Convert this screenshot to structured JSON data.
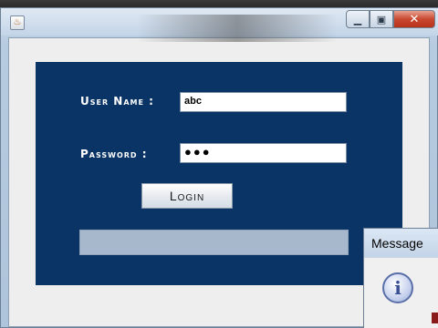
{
  "window": {
    "app_icon_glyph": "♨",
    "controls": {
      "minimize_glyph": "▁",
      "maximize_glyph": "▣",
      "close_glyph": "✕"
    }
  },
  "login_form": {
    "username_label": "User Name :",
    "username_value": "abc",
    "password_label": "Password :",
    "password_value": "●●●",
    "login_button_label": "Login"
  },
  "message_dialog": {
    "title": "Message",
    "icon": "info-icon",
    "icon_glyph": "i"
  },
  "colors": {
    "panel_background": "#0a3366",
    "status_bar": "#a7b8cc",
    "close_button": "#c8482f"
  }
}
